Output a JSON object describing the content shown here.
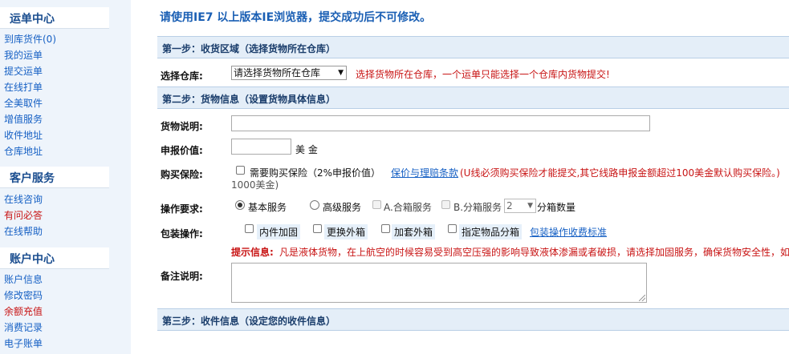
{
  "sidebar": {
    "sections": [
      {
        "title": "运单中心",
        "items": [
          "到库货件(0)",
          "我的运单",
          "提交运单",
          "在线打单",
          "全美取件",
          "增值服务",
          "收件地址",
          "仓库地址"
        ]
      },
      {
        "title": "客户服务",
        "items": [
          "在线咨询",
          "有问必答",
          "在线帮助"
        ]
      },
      {
        "title": "账户中心",
        "items": [
          "账户信息",
          "修改密码",
          "余额充值",
          "消费记录",
          "电子账单"
        ]
      }
    ]
  },
  "notice": "请使用IE7 以上版本IE浏览器，提交成功后不可修改。",
  "steps": {
    "step1": "第一步：收货区域（选择货物所在仓库）",
    "step2": "第二步：货物信息（设置货物具体信息）",
    "step3": "第三步：收件信息（设定您的收件信息）"
  },
  "warehouse": {
    "label": "选择仓库:",
    "selected": "请选择货物所在仓库",
    "hint": "选择货物所在仓库，一个运单只能选择一个仓库内货物提交!"
  },
  "goods": {
    "desc_label": "货物说明:",
    "value_label": "申报价值:",
    "value_unit": "美 金",
    "insurance_label": "购买保险:",
    "insurance_option": "需要购买保险（2%申报价值）",
    "insurance_link": "保价与理赔条款",
    "insurance_note": "(U线必须购买保险才能提交,其它线路申报金额超过100美金默认购买保险。)",
    "insurance_note2": "1000美金)",
    "operation_label": "操作要求:",
    "operation_basic": "基本服务",
    "operation_advanced": "高级服务",
    "operation_merge": "A.合箱服务",
    "operation_split": "B.分箱服务",
    "split_count": "2",
    "split_unit": "分箱数量",
    "packing_label": "包装操作:",
    "packing_options": [
      "内件加固",
      "更换外箱",
      "加套外箱",
      "指定物品分箱"
    ],
    "packing_link": "包装操作收费标准",
    "tip_label": "提示信息:",
    "tip_text": "凡是液体货物，在上航空的时候容易受到高空压强的影响导致液体渗漏或者破损，请选择加固服务，确保货物安全性，如",
    "remark_label": "备注说明:"
  }
}
